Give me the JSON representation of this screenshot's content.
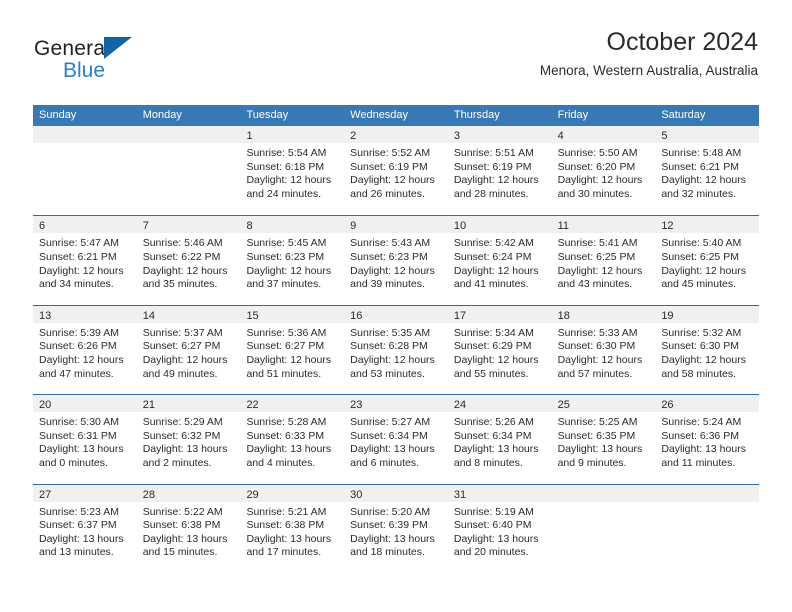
{
  "logo": {
    "word_one": "General",
    "word_two": "Blue",
    "triangle_color": "#1464a5",
    "blue_color": "#2a7fc9"
  },
  "header": {
    "title": "October 2024",
    "subtitle": "Menora, Western Australia, Australia"
  },
  "theme": {
    "header_blue": "#3878b4",
    "week_divider": "#2f6ea8",
    "daynum_band": "#f0f0f0",
    "text": "#2b2b2b"
  },
  "calendar": {
    "day_headers": [
      "Sunday",
      "Monday",
      "Tuesday",
      "Wednesday",
      "Thursday",
      "Friday",
      "Saturday"
    ],
    "weeks": [
      [
        {
          "day": "",
          "lines": []
        },
        {
          "day": "",
          "lines": []
        },
        {
          "day": "1",
          "lines": [
            "Sunrise: 5:54 AM",
            "Sunset: 6:18 PM",
            "Daylight: 12 hours",
            "and 24 minutes."
          ]
        },
        {
          "day": "2",
          "lines": [
            "Sunrise: 5:52 AM",
            "Sunset: 6:19 PM",
            "Daylight: 12 hours",
            "and 26 minutes."
          ]
        },
        {
          "day": "3",
          "lines": [
            "Sunrise: 5:51 AM",
            "Sunset: 6:19 PM",
            "Daylight: 12 hours",
            "and 28 minutes."
          ]
        },
        {
          "day": "4",
          "lines": [
            "Sunrise: 5:50 AM",
            "Sunset: 6:20 PM",
            "Daylight: 12 hours",
            "and 30 minutes."
          ]
        },
        {
          "day": "5",
          "lines": [
            "Sunrise: 5:48 AM",
            "Sunset: 6:21 PM",
            "Daylight: 12 hours",
            "and 32 minutes."
          ]
        }
      ],
      [
        {
          "day": "6",
          "lines": [
            "Sunrise: 5:47 AM",
            "Sunset: 6:21 PM",
            "Daylight: 12 hours",
            "and 34 minutes."
          ]
        },
        {
          "day": "7",
          "lines": [
            "Sunrise: 5:46 AM",
            "Sunset: 6:22 PM",
            "Daylight: 12 hours",
            "and 35 minutes."
          ]
        },
        {
          "day": "8",
          "lines": [
            "Sunrise: 5:45 AM",
            "Sunset: 6:23 PM",
            "Daylight: 12 hours",
            "and 37 minutes."
          ]
        },
        {
          "day": "9",
          "lines": [
            "Sunrise: 5:43 AM",
            "Sunset: 6:23 PM",
            "Daylight: 12 hours",
            "and 39 minutes."
          ]
        },
        {
          "day": "10",
          "lines": [
            "Sunrise: 5:42 AM",
            "Sunset: 6:24 PM",
            "Daylight: 12 hours",
            "and 41 minutes."
          ]
        },
        {
          "day": "11",
          "lines": [
            "Sunrise: 5:41 AM",
            "Sunset: 6:25 PM",
            "Daylight: 12 hours",
            "and 43 minutes."
          ]
        },
        {
          "day": "12",
          "lines": [
            "Sunrise: 5:40 AM",
            "Sunset: 6:25 PM",
            "Daylight: 12 hours",
            "and 45 minutes."
          ]
        }
      ],
      [
        {
          "day": "13",
          "lines": [
            "Sunrise: 5:39 AM",
            "Sunset: 6:26 PM",
            "Daylight: 12 hours",
            "and 47 minutes."
          ]
        },
        {
          "day": "14",
          "lines": [
            "Sunrise: 5:37 AM",
            "Sunset: 6:27 PM",
            "Daylight: 12 hours",
            "and 49 minutes."
          ]
        },
        {
          "day": "15",
          "lines": [
            "Sunrise: 5:36 AM",
            "Sunset: 6:27 PM",
            "Daylight: 12 hours",
            "and 51 minutes."
          ]
        },
        {
          "day": "16",
          "lines": [
            "Sunrise: 5:35 AM",
            "Sunset: 6:28 PM",
            "Daylight: 12 hours",
            "and 53 minutes."
          ]
        },
        {
          "day": "17",
          "lines": [
            "Sunrise: 5:34 AM",
            "Sunset: 6:29 PM",
            "Daylight: 12 hours",
            "and 55 minutes."
          ]
        },
        {
          "day": "18",
          "lines": [
            "Sunrise: 5:33 AM",
            "Sunset: 6:30 PM",
            "Daylight: 12 hours",
            "and 57 minutes."
          ]
        },
        {
          "day": "19",
          "lines": [
            "Sunrise: 5:32 AM",
            "Sunset: 6:30 PM",
            "Daylight: 12 hours",
            "and 58 minutes."
          ]
        }
      ],
      [
        {
          "day": "20",
          "lines": [
            "Sunrise: 5:30 AM",
            "Sunset: 6:31 PM",
            "Daylight: 13 hours",
            "and 0 minutes."
          ]
        },
        {
          "day": "21",
          "lines": [
            "Sunrise: 5:29 AM",
            "Sunset: 6:32 PM",
            "Daylight: 13 hours",
            "and 2 minutes."
          ]
        },
        {
          "day": "22",
          "lines": [
            "Sunrise: 5:28 AM",
            "Sunset: 6:33 PM",
            "Daylight: 13 hours",
            "and 4 minutes."
          ]
        },
        {
          "day": "23",
          "lines": [
            "Sunrise: 5:27 AM",
            "Sunset: 6:34 PM",
            "Daylight: 13 hours",
            "and 6 minutes."
          ]
        },
        {
          "day": "24",
          "lines": [
            "Sunrise: 5:26 AM",
            "Sunset: 6:34 PM",
            "Daylight: 13 hours",
            "and 8 minutes."
          ]
        },
        {
          "day": "25",
          "lines": [
            "Sunrise: 5:25 AM",
            "Sunset: 6:35 PM",
            "Daylight: 13 hours",
            "and 9 minutes."
          ]
        },
        {
          "day": "26",
          "lines": [
            "Sunrise: 5:24 AM",
            "Sunset: 6:36 PM",
            "Daylight: 13 hours",
            "and 11 minutes."
          ]
        }
      ],
      [
        {
          "day": "27",
          "lines": [
            "Sunrise: 5:23 AM",
            "Sunset: 6:37 PM",
            "Daylight: 13 hours",
            "and 13 minutes."
          ]
        },
        {
          "day": "28",
          "lines": [
            "Sunrise: 5:22 AM",
            "Sunset: 6:38 PM",
            "Daylight: 13 hours",
            "and 15 minutes."
          ]
        },
        {
          "day": "29",
          "lines": [
            "Sunrise: 5:21 AM",
            "Sunset: 6:38 PM",
            "Daylight: 13 hours",
            "and 17 minutes."
          ]
        },
        {
          "day": "30",
          "lines": [
            "Sunrise: 5:20 AM",
            "Sunset: 6:39 PM",
            "Daylight: 13 hours",
            "and 18 minutes."
          ]
        },
        {
          "day": "31",
          "lines": [
            "Sunrise: 5:19 AM",
            "Sunset: 6:40 PM",
            "Daylight: 13 hours",
            "and 20 minutes."
          ]
        },
        {
          "day": "",
          "lines": []
        },
        {
          "day": "",
          "lines": []
        }
      ]
    ]
  }
}
